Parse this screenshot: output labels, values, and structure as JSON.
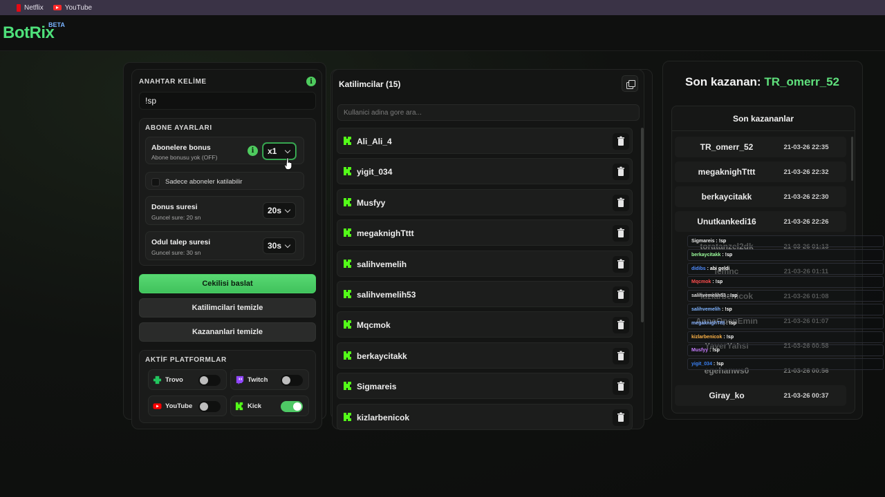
{
  "bookmarks": [
    {
      "label": "Netflix",
      "icon": "netflix-icon"
    },
    {
      "label": "YouTube",
      "icon": "youtube-icon"
    }
  ],
  "app": {
    "logo": "BotRix",
    "badge": "BETA"
  },
  "left": {
    "keyword_title": "ANAHTAR KELİME",
    "keyword_value": "!sp",
    "sub_section_title": "ABONE AYARLARI",
    "sub_bonus_title": "Abonelere bonus",
    "sub_bonus_sub": "Abone bonusu yok (OFF)",
    "sub_bonus_value": "x1",
    "subs_only_label": "Sadece aboneler katilabilir",
    "draw_time_title": "Donus suresi",
    "draw_time_sub": "Guncel sure: 20 sn",
    "draw_time_value": "20s",
    "claim_time_title": "Odul talep suresi",
    "claim_time_sub": "Guncel sure: 30 sn",
    "claim_time_value": "30s",
    "start_button": "Cekilisi baslat",
    "clear_participants_button": "Katilimcilari temizle",
    "clear_winners_button": "Kazananlari temizle",
    "platforms_title": "AKTİF PLATFORMLAR",
    "platforms": [
      {
        "name": "Trovo",
        "enabled": false,
        "color": "#22c55e"
      },
      {
        "name": "Twitch",
        "enabled": false,
        "color": "#9146ff"
      },
      {
        "name": "YouTube",
        "enabled": false,
        "color": "#ff0000"
      },
      {
        "name": "Kick",
        "enabled": true,
        "color": "#53fc18"
      }
    ]
  },
  "middle": {
    "title": "Katilimcilar (15)",
    "search_placeholder": "Kullanici adina gore ara...",
    "participants": [
      "Ali_Ali_4",
      "yigit_034",
      "Musfyy",
      "megaknighTttt",
      "salihvemelih",
      "salihvemelih53",
      "Mqcmok",
      "berkaycitakk",
      "Sigmareis",
      "kizlarbenicok"
    ]
  },
  "right": {
    "last_winner_label": "Son kazanan:",
    "last_winner_name": "TR_omerr_52",
    "list_title": "Son kazananlar",
    "winners": [
      {
        "name": "TR_omerr_52",
        "date": "21-03-26 22:35"
      },
      {
        "name": "megaknighTttt",
        "date": "21-03-26 22:32"
      },
      {
        "name": "berkaycitakk",
        "date": "21-03-26 22:30"
      },
      {
        "name": "Unutkankedi16",
        "date": "21-03-26 22:26"
      },
      {
        "name": "toratanzel2dk",
        "date": "21-03-26 01:13"
      },
      {
        "name": "lemnc",
        "date": "21-03-26 01:11"
      },
      {
        "name": "kizlarbenicok",
        "date": "21-03-26 01:08"
      },
      {
        "name": "AnneOpenEmin",
        "date": "21-03-26 01:07"
      },
      {
        "name": "YaverYahsi",
        "date": "21-03-26 00:58"
      },
      {
        "name": "egehanws0",
        "date": "21-03-26 00:56"
      },
      {
        "name": "Giray_ko",
        "date": "21-03-26 00:37"
      }
    ]
  },
  "chat": [
    {
      "user": "Sigmareis",
      "msg": ": !sp",
      "color": "#e8e8e8"
    },
    {
      "user": "berkaycitakk",
      "msg": ": !sp",
      "color": "#9dff9d"
    },
    {
      "user": "didibs",
      "msg": ": abi geldi",
      "color": "#4f8cff"
    },
    {
      "user": "Mqcmok",
      "msg": ": !sp",
      "color": "#ff4d4d"
    },
    {
      "user": "salihvemelih53",
      "msg": ": !sp",
      "color": "#dcdcdc"
    },
    {
      "user": "salihvemelih",
      "msg": ": !sp",
      "color": "#7fb3ff"
    },
    {
      "user": "megaknighTttt",
      "msg": ": !sp",
      "color": "#8ab4ff"
    },
    {
      "user": "kizlarbenicok",
      "msg": ": !sp",
      "color": "#ffb347"
    },
    {
      "user": "Musfyy",
      "msg": ": !sp",
      "color": "#c77dff"
    },
    {
      "user": "yigit_034",
      "msg": ": !sp",
      "color": "#3b82f6"
    }
  ]
}
